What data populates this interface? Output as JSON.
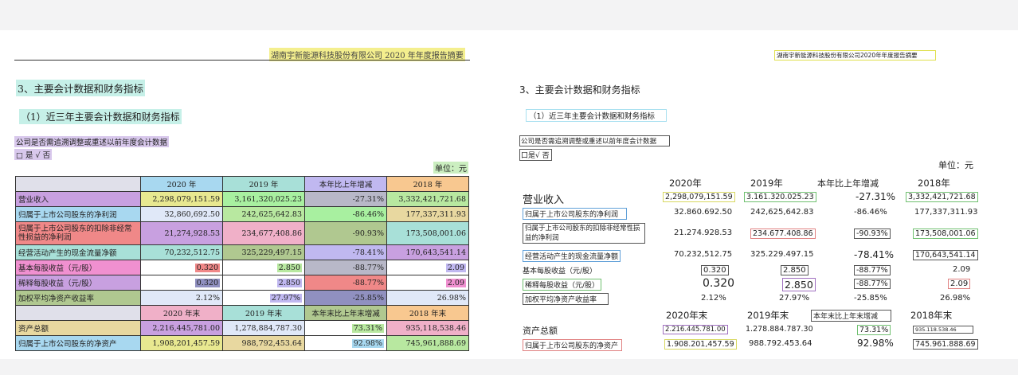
{
  "left": {
    "header": "湖南宇新能源科技股份有限公司 2020 年年度报告摘要",
    "section_title": "3、主要会计数据和财务指标",
    "subsection_title": "（1）近三年主要会计数据和财务指标",
    "question": "公司是否需追溯调整或重述以前年度会计数据",
    "answer": "□ 是 √ 否",
    "unit": "单位：元",
    "headers": [
      "",
      "2020 年",
      "2019 年",
      "本年比上年增减",
      "2018 年"
    ],
    "rows": [
      [
        "营业收入",
        "2,298,079,151.59",
        "3,161,320,025.23",
        "-27.31%",
        "3,332,421,721.68"
      ],
      [
        "归属于上市公司股东的净利润",
        "32,860,692.50",
        "242,625,642.83",
        "-86.46%",
        "177,337,311.93"
      ],
      [
        "归属于上市公司股东的扣除非经常性损益的净利润",
        "21,274,928.53",
        "234,677,408.86",
        "-90.93%",
        "173,508,001.06"
      ],
      [
        "经营活动产生的现金流量净额",
        "70,232,512.75",
        "325,229,497.15",
        "-78.41%",
        "170,643,541.14"
      ],
      [
        "基本每股收益（元/股）",
        "0.320",
        "2.850",
        "-88.77%",
        "2.09"
      ],
      [
        "稀释每股收益（元/股）",
        "0.320",
        "2.850",
        "-88.77%",
        "2.09"
      ],
      [
        "加权平均净资产收益率",
        "2.12%",
        "27.97%",
        "-25.85%",
        "26.98%"
      ]
    ],
    "headers2": [
      "",
      "2020 年末",
      "2019 年末",
      "本年末比上年末增减",
      "2018 年末"
    ],
    "rows2": [
      [
        "资产总额",
        "2,216,445,781.00",
        "1,278,884,787.30",
        "73.31%",
        "935,118,538.46"
      ],
      [
        "归属于上市公司股东的净资产",
        "1,908,201,457.59",
        "988,792,453.64",
        "92.98%",
        "745,961,888.69"
      ]
    ]
  },
  "right": {
    "header": "湖南宇新能源科技股份有限公司2020年年度报告摘要",
    "section_title": "3、主要会计数据和财务指标",
    "subsection_title": "（1）近三年主要会计数据和财务指标",
    "question": "公司是否需追溯调整或重述以前年度会计数据",
    "answer": "口是√ 否",
    "unit": "单位：元",
    "headers": [
      "2020年",
      "2019年",
      "本年比上年增减",
      "2018年"
    ],
    "rows": [
      [
        "营业收入",
        "2,298,079,151.59",
        "3.161.320.025.23",
        "-27.31%",
        "3,332,421,721.68"
      ],
      [
        "归属于上市公司股东的净利润",
        "32.860.692.50",
        "242,625,642.83",
        "-86.46%",
        "177,337,311.93"
      ],
      [
        "归属于上市公司股东的扣除非经常性损益的净利润",
        "21.274.928.53",
        "234.677.408.86",
        "-90.93%",
        "173,508,001.06"
      ],
      [
        "经营活动产生的现金流量净额",
        "70.232,512.75",
        "325.229.497.15",
        "-78.41%",
        "170,643,541.14"
      ],
      [
        "基本每股收益（元/股）",
        "0.320",
        "2.850",
        "-88.77%",
        "2.09"
      ],
      [
        "稀释每股收益（元/股）",
        "0.320",
        "2.850",
        "-88.77%",
        "2.09"
      ],
      [
        "加权平均净资产收益率",
        "2.12%",
        "27.97%",
        "-25.85%",
        "26.98%"
      ]
    ],
    "headers2": [
      "2020年末",
      "2019年末",
      "本年末比上年末增减",
      "2018年末"
    ],
    "rows2": [
      [
        "资产总额",
        "2.216.445.781.00",
        "1.278.884.787.30",
        "73.31%",
        "935.118.538.46"
      ],
      [
        "归属于上市公司股东的净资产",
        "1.908.201,457.59",
        "988.792.453.64",
        "92.98%",
        "745.961.888.69"
      ]
    ]
  }
}
